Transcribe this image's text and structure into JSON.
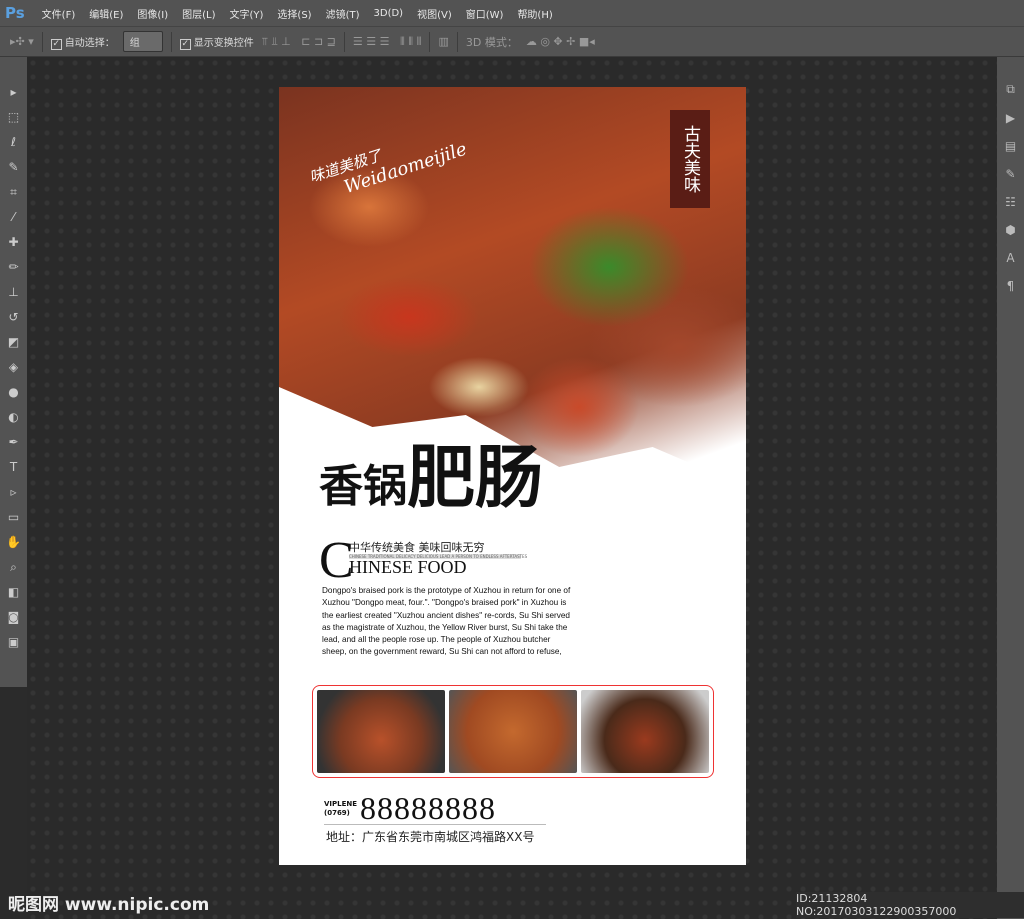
{
  "app": {
    "logo": "Ps",
    "menu": [
      "文件(F)",
      "编辑(E)",
      "图像(I)",
      "图层(L)",
      "文字(Y)",
      "选择(S)",
      "滤镜(T)",
      "3D(D)",
      "视图(V)",
      "窗口(W)",
      "帮助(H)"
    ]
  },
  "options": {
    "auto_select_label": "自动选择：",
    "auto_select_value": "组",
    "show_transform_label": "显示变换控件",
    "mode_3d_label": "3D 模式："
  },
  "poster": {
    "seal": "古夫美味",
    "script_cn": "味道美极了",
    "script_en": "Weidaomeijile",
    "title_small": "香锅",
    "title_big": "肥肠",
    "cn_line": "中华传统美食  美味回味无穷",
    "cn_sub": "CHINESE TRADITIONAL DELICACY DELICIOUS LEAD A PERSON TO ENDLESS AFTERTASTES",
    "big_c": "C",
    "en_line": "HINESE FOOD",
    "description": "Dongpo's braised pork is the prototype of Xuzhou in return for one of Xuzhou \"Dongpo meat, four.\". \"Dongpo's braised pork\" in Xuzhou is the earliest created \"Xuzhou ancient dishes\" re-cords, Su Shi served as the magistrate of Xuzhou, the Yellow River burst, Su Shi take the lead, and all the people rose up. The people of Xuzhou butcher sheep, on the government reward, Su Shi can not afford to refuse,",
    "phone_label": "VIPLENE",
    "area_code": "(0769)",
    "phone": "88888888",
    "address": "地址：广东省东莞市南城区鸿福路XX号"
  },
  "watermark": "昵图网 www.nipic.com",
  "id_text": "ID:21132804 NO:20170303122900357000"
}
